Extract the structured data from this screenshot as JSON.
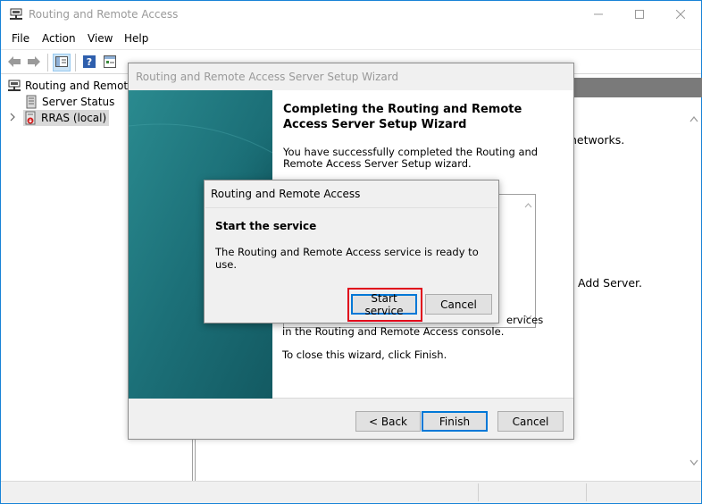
{
  "app": {
    "title": "Routing and Remote Access",
    "icon": "network-server-icon",
    "window_controls": [
      "minimize-icon",
      "maximize-icon",
      "close-icon"
    ]
  },
  "menu": [
    "File",
    "Action",
    "View",
    "Help"
  ],
  "toolbar": {
    "buttons": [
      "back-arrow-icon",
      "forward-arrow-icon",
      "show-hide-tree-icon",
      "help-icon",
      "properties-icon"
    ]
  },
  "tree": {
    "root": "Routing and Remote Access",
    "items": [
      {
        "label": "Server Status",
        "icon": "server-status-icon"
      },
      {
        "label": "RRAS (local)",
        "icon": "server-down-icon",
        "selected": true
      }
    ]
  },
  "content": {
    "line1": "networks.",
    "line2": "Add Server."
  },
  "wizard": {
    "title": "Routing and Remote Access Server Setup Wizard",
    "heading": "Completing the Routing and Remote Access Server Setup Wizard",
    "intro": "You have successfully completed the Routing and Remote Access Server Setup wizard.",
    "services_line1": "ervices",
    "services_line2": "in the Routing and  Remote Access console.",
    "close_text": "To close this wizard, click Finish.",
    "buttons": {
      "back": "< Back",
      "finish": "Finish",
      "cancel": "Cancel"
    }
  },
  "dialog": {
    "title": "Routing and Remote Access",
    "heading": "Start the service",
    "message": "The Routing and Remote Access service is ready to use.",
    "buttons": {
      "start": "Start service",
      "cancel": "Cancel"
    }
  },
  "colors": {
    "window_border": "#1883d7",
    "banner_teal": "#1f7c84",
    "highlight": "#e0001a",
    "header_gray": "#7a7a7a"
  }
}
